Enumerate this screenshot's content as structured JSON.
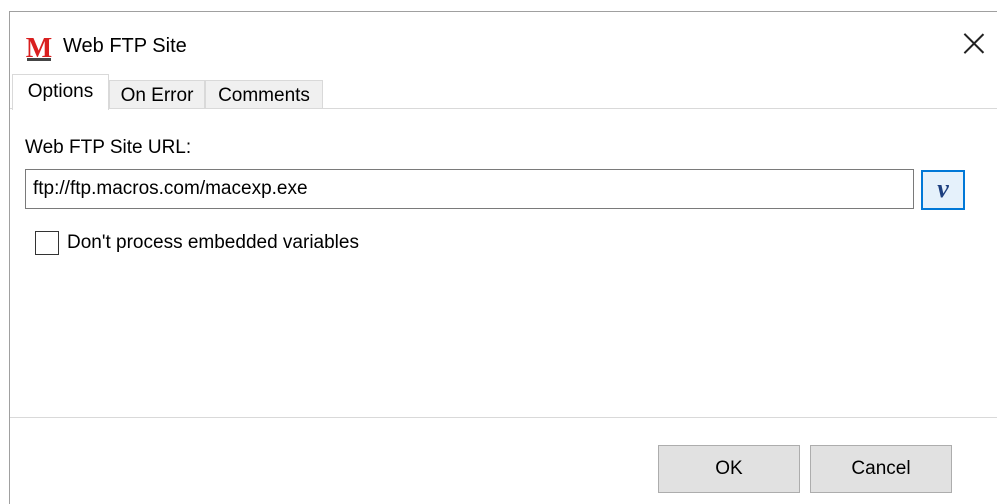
{
  "window": {
    "title": "Web FTP Site",
    "logo_letter": "M",
    "logo_color": "#d91f1f"
  },
  "tabs": [
    {
      "label": "Options",
      "active": true
    },
    {
      "label": "On Error",
      "active": false
    },
    {
      "label": "Comments",
      "active": false
    }
  ],
  "form": {
    "url_label": "Web FTP Site URL:",
    "url_value": "ftp://ftp.macros.com/macexp.exe",
    "variable_button_label": "v",
    "checkbox_label": "Don't process embedded variables",
    "checkbox_checked": false
  },
  "buttons": {
    "ok": "OK",
    "cancel": "Cancel"
  },
  "colors": {
    "accent": "#0078d7",
    "button_bg": "#e1e1e1",
    "tab_bg": "#f0f0f0"
  },
  "icons": {
    "app": "macro-express-logo-icon",
    "close": "close-icon"
  }
}
